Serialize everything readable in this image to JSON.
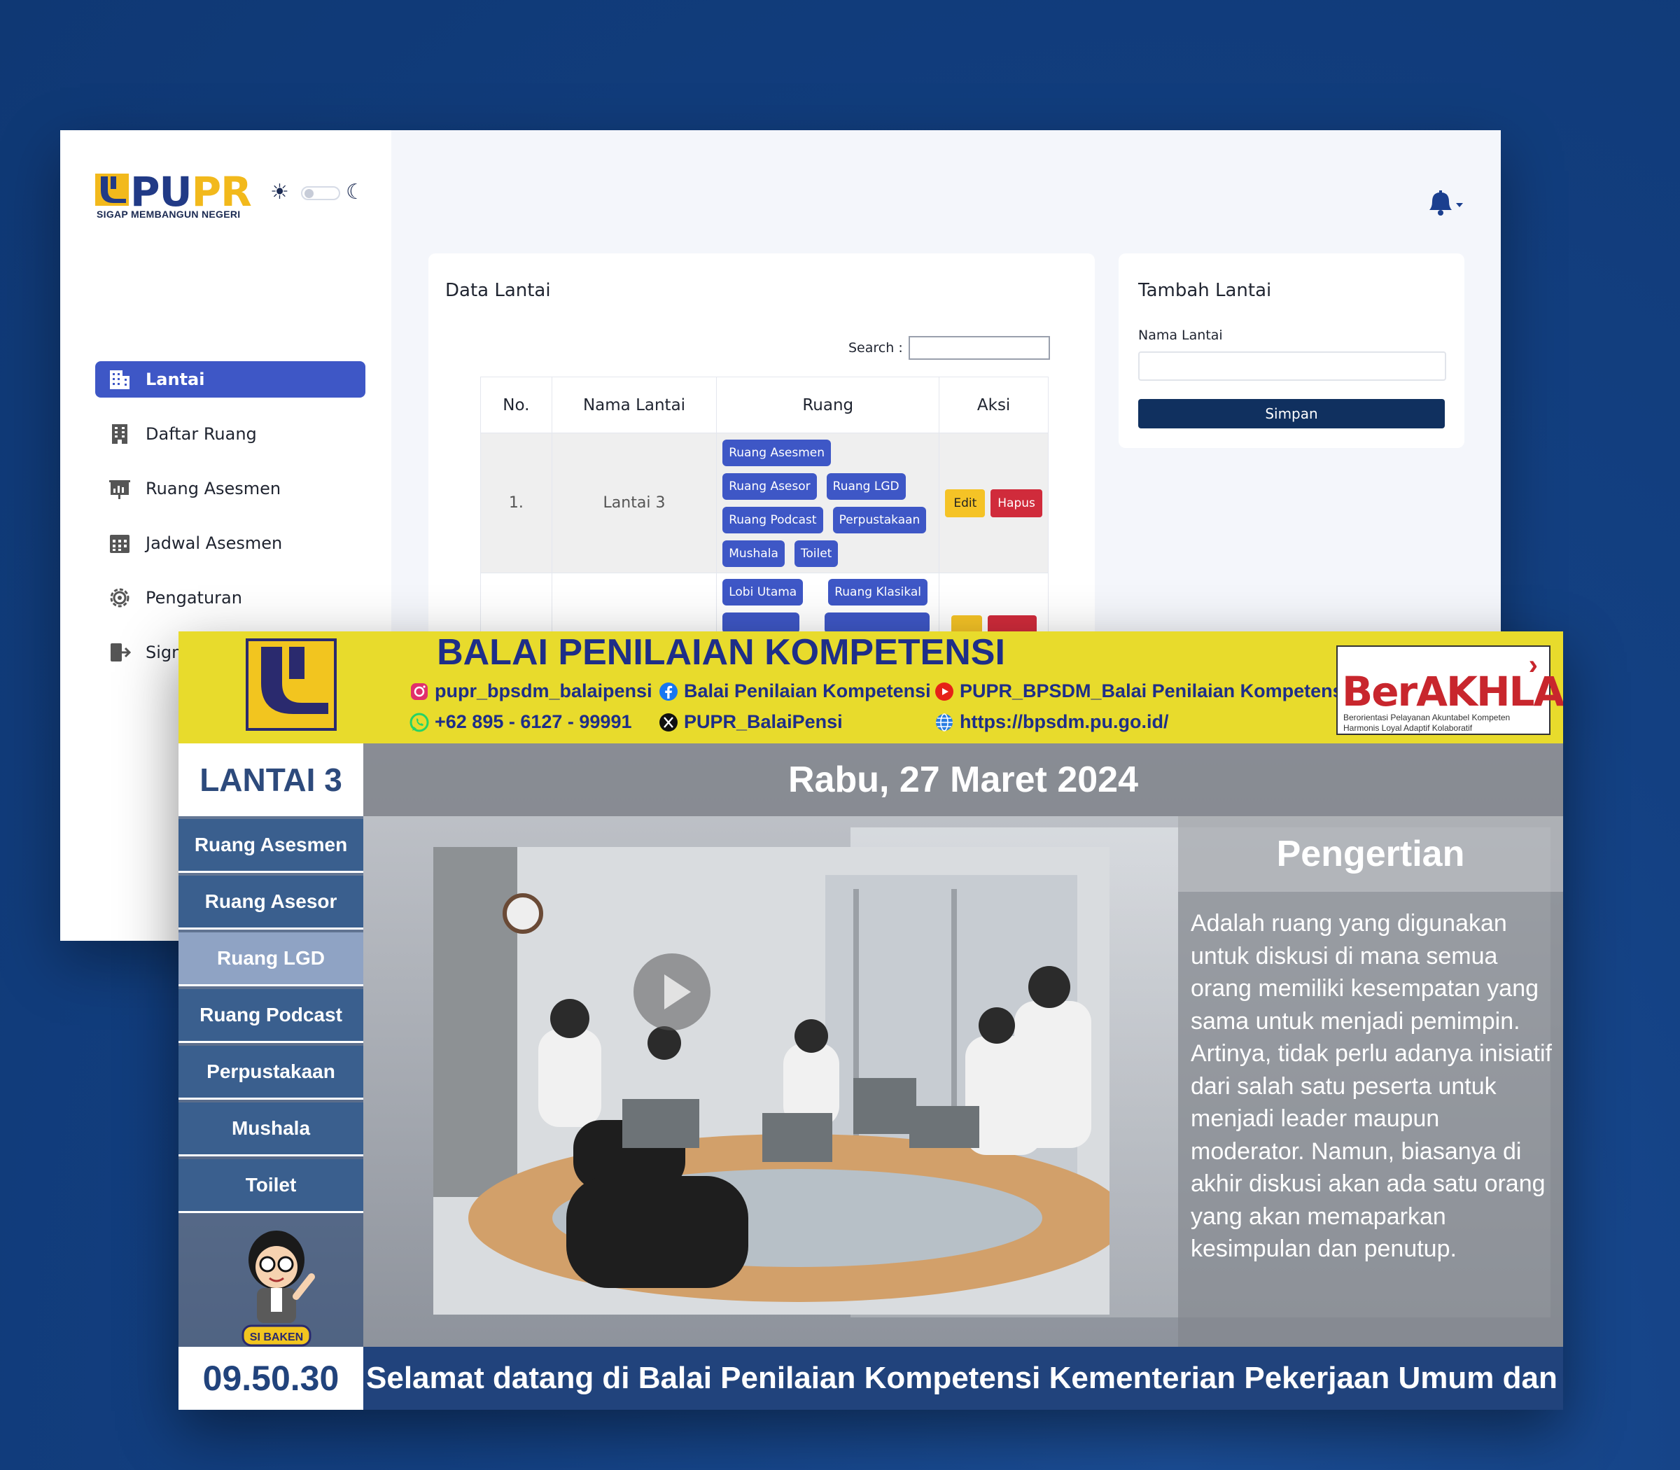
{
  "admin": {
    "logo": {
      "text_main": "PU",
      "text_accent": "PR",
      "tagline": "SIGAP MEMBANGUN NEGERI"
    },
    "nav": [
      {
        "label": "Lantai",
        "icon": "building-icon",
        "active": true
      },
      {
        "label": "Daftar Ruang",
        "icon": "office-building-icon",
        "active": false
      },
      {
        "label": "Ruang Asesmen",
        "icon": "presentation-icon",
        "active": false
      },
      {
        "label": "Jadwal Asesmen",
        "icon": "calendar-grid-icon",
        "active": false
      },
      {
        "label": "Pengaturan",
        "icon": "gear-icon",
        "active": false
      },
      {
        "label": "Sign",
        "icon": "sign-out-icon",
        "active": false
      }
    ],
    "data_card": {
      "title": "Data Lantai",
      "search_label": "Search :",
      "columns": [
        "No.",
        "Nama Lantai",
        "Ruang",
        "Aksi"
      ],
      "rows": [
        {
          "no": "1.",
          "nama": "Lantai 3",
          "ruang": [
            "Ruang Asesmen",
            "Ruang Asesor",
            "Ruang LGD",
            "Ruang Podcast",
            "Perpustakaan",
            "Mushala",
            "Toilet"
          ],
          "edit": "Edit",
          "hapus": "Hapus"
        },
        {
          "no": "",
          "nama": "",
          "ruang": [
            "Lobi Utama",
            "Ruang Klasikal"
          ],
          "edit": "",
          "hapus": ""
        }
      ]
    },
    "add_card": {
      "title": "Tambah Lantai",
      "field_label": "Nama Lantai",
      "field_value": "",
      "submit": "Simpan"
    }
  },
  "signage": {
    "title": "BALAI PENILAIAN KOMPETENSI",
    "socials": {
      "instagram": "pupr_bpsdm_balaipensi",
      "facebook": "Balai Penilaian Kompetensi",
      "youtube": "PUPR_BPSDM_Balai Penilaian Kompetensi",
      "whatsapp": "+62 895 - 6127 - 99991",
      "x": "PUPR_BalaiPensi",
      "web": "https://bpsdm.pu.go.id/"
    },
    "berakhlak": {
      "name": "BerAKHLAK",
      "tagline": "Berorientasi Pelayanan Akuntabel Kompeten Harmonis Loyal Adaptif Kolaboratif"
    },
    "floor": "LANTAI 3",
    "date": "Rabu, 27 Maret 2024",
    "rooms": [
      {
        "label": "Ruang Asesmen",
        "active": false
      },
      {
        "label": "Ruang Asesor",
        "active": false
      },
      {
        "label": "Ruang LGD",
        "active": true
      },
      {
        "label": "Ruang Podcast",
        "active": false
      },
      {
        "label": "Perpustakaan",
        "active": false
      },
      {
        "label": "Mushala",
        "active": false
      },
      {
        "label": "Toilet",
        "active": false
      }
    ],
    "mascot_label": "SI BAKEN",
    "info_title": "Pengertian",
    "info_text": "Adalah ruang yang digunakan untuk diskusi di mana semua orang memiliki kesempatan yang sama untuk menjadi pemimpin. Artinya, tidak perlu adanya inisiatif dari salah satu peserta untuk menjadi leader maupun moderator. Namun, biasanya di akhir diskusi akan ada satu orang yang akan memaparkan kesimpulan dan penutup.",
    "clock": "09.50.30",
    "ticker": "Selamat datang di Balai Penilaian Kompetensi Kementerian Pekerjaan Umum dan"
  },
  "colors": {
    "background": "#134082",
    "accent_blue": "#3e57c6",
    "navy": "#10305f",
    "edit": "#f5c326",
    "hapus": "#d02b3b",
    "signage_yellow": "#e8db2c",
    "signage_blue": "#21437c"
  }
}
